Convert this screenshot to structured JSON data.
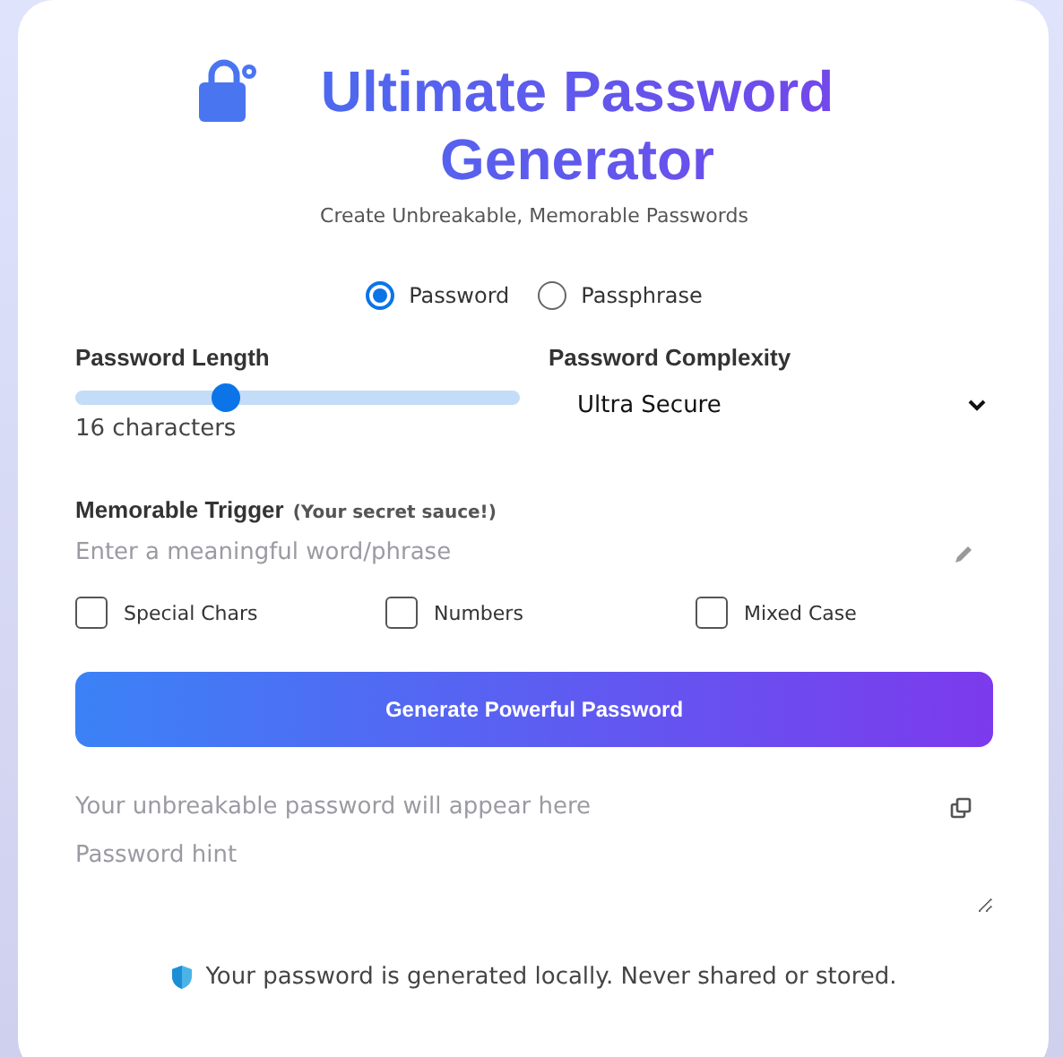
{
  "title": "Ultimate Password Generator",
  "subtitle": "Create Unbreakable, Memorable Passwords",
  "modes": [
    {
      "label": "Password",
      "selected": true
    },
    {
      "label": "Passphrase",
      "selected": false
    }
  ],
  "length": {
    "label": "Password Length",
    "level": 0.34,
    "reading": "16 characters"
  },
  "complexity": {
    "label": "Password Complexity",
    "value": "Ultra Secure"
  },
  "trigger": {
    "label": "Memorable Trigger",
    "note": "(Your secret sauce!)",
    "placeholder": "Enter a meaningful word/phrase"
  },
  "options": [
    {
      "label": "Special Chars",
      "checked": false
    },
    {
      "label": "Numbers",
      "checked": false
    },
    {
      "label": "Mixed Case",
      "checked": false
    }
  ],
  "generate_button": "Generate Powerful Password",
  "output": {
    "placeholder": "Your unbreakable password will appear here"
  },
  "hint": {
    "placeholder": "Password hint"
  },
  "footer": "Your password is generated locally. Never shared or stored."
}
